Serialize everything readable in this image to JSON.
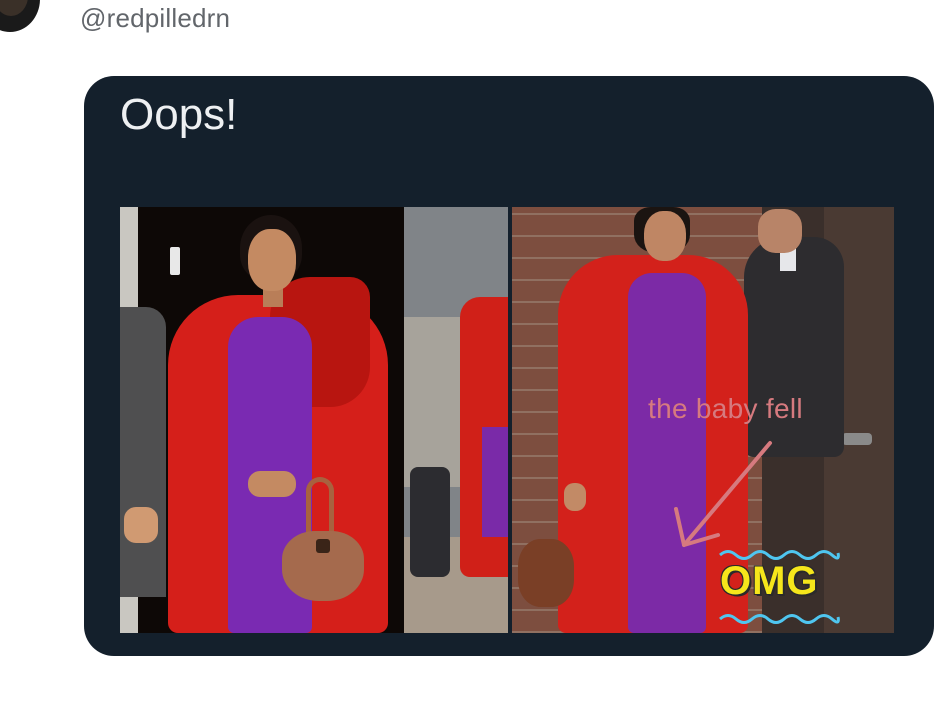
{
  "tweet": {
    "handle": "@redpilledrn",
    "caption": "Oops!"
  },
  "annotations": {
    "note": "the baby fell",
    "exclaim": "OMG"
  },
  "colors": {
    "card_background": "#14202c",
    "coat": "#d51f1a",
    "dress": "#7a2ab2",
    "annotation_text": "#d67a7f",
    "omg_text": "#f6e61b",
    "wave": "#4fc6f0"
  }
}
